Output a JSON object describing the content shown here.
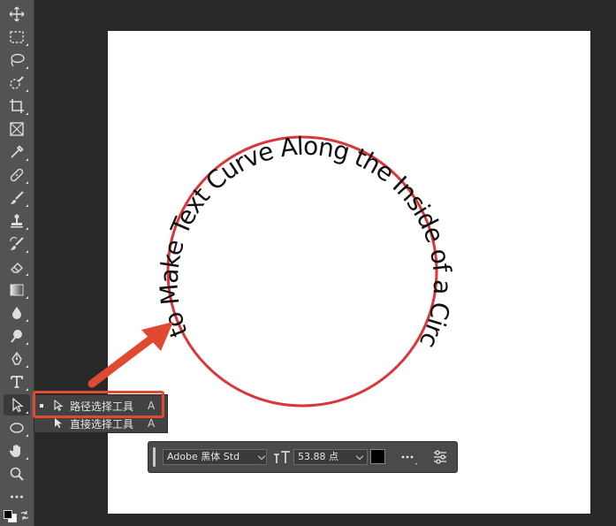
{
  "toolbar": {
    "tools": [
      {
        "name": "move-tool",
        "icon": "move-icon"
      },
      {
        "name": "marquee-tool",
        "icon": "rect-marquee-icon"
      },
      {
        "name": "lasso-tool",
        "icon": "lasso-icon"
      },
      {
        "name": "quick-select-tool",
        "icon": "quick-select-icon"
      },
      {
        "name": "crop-tool",
        "icon": "crop-icon"
      },
      {
        "name": "frame-tool",
        "icon": "frame-icon"
      },
      {
        "name": "eyedropper-tool",
        "icon": "eyedropper-icon"
      },
      {
        "name": "healing-tool",
        "icon": "bandage-icon"
      },
      {
        "name": "brush-tool",
        "icon": "brush-icon"
      },
      {
        "name": "stamp-tool",
        "icon": "stamp-icon"
      },
      {
        "name": "history-brush-tool",
        "icon": "history-brush-icon"
      },
      {
        "name": "eraser-tool",
        "icon": "eraser-icon"
      },
      {
        "name": "gradient-tool",
        "icon": "gradient-icon"
      },
      {
        "name": "blur-tool",
        "icon": "droplet-icon"
      },
      {
        "name": "dodge-tool",
        "icon": "dodge-icon"
      },
      {
        "name": "pen-tool",
        "icon": "pen-icon"
      },
      {
        "name": "type-tool",
        "icon": "type-icon"
      },
      {
        "name": "path-selection-tool",
        "icon": "arrow-cursor-icon"
      },
      {
        "name": "shape-tool",
        "icon": "ellipse-icon"
      },
      {
        "name": "hand-tool",
        "icon": "hand-icon"
      },
      {
        "name": "zoom-tool",
        "icon": "zoom-icon"
      },
      {
        "name": "edit-toolbar",
        "icon": "more-icon"
      }
    ],
    "colors": {
      "foreground": "#000000",
      "background": "#ffffff"
    }
  },
  "canvas": {
    "circle_text": "How to Make Text Curve Along the Inside of a Circle in",
    "circle_stroke": "#d8383a",
    "text_color": "#111111"
  },
  "flyout": {
    "items": [
      {
        "label": "路径选择工具",
        "shortcut": "A",
        "selected": true
      },
      {
        "label": "直接选择工具",
        "shortcut": "A",
        "selected": false
      }
    ]
  },
  "options": {
    "font_family": "Adobe 黑体 Std",
    "font_size": "53.88 点",
    "text_color": "#000000"
  },
  "annotation": {
    "color": "#e04a33"
  }
}
